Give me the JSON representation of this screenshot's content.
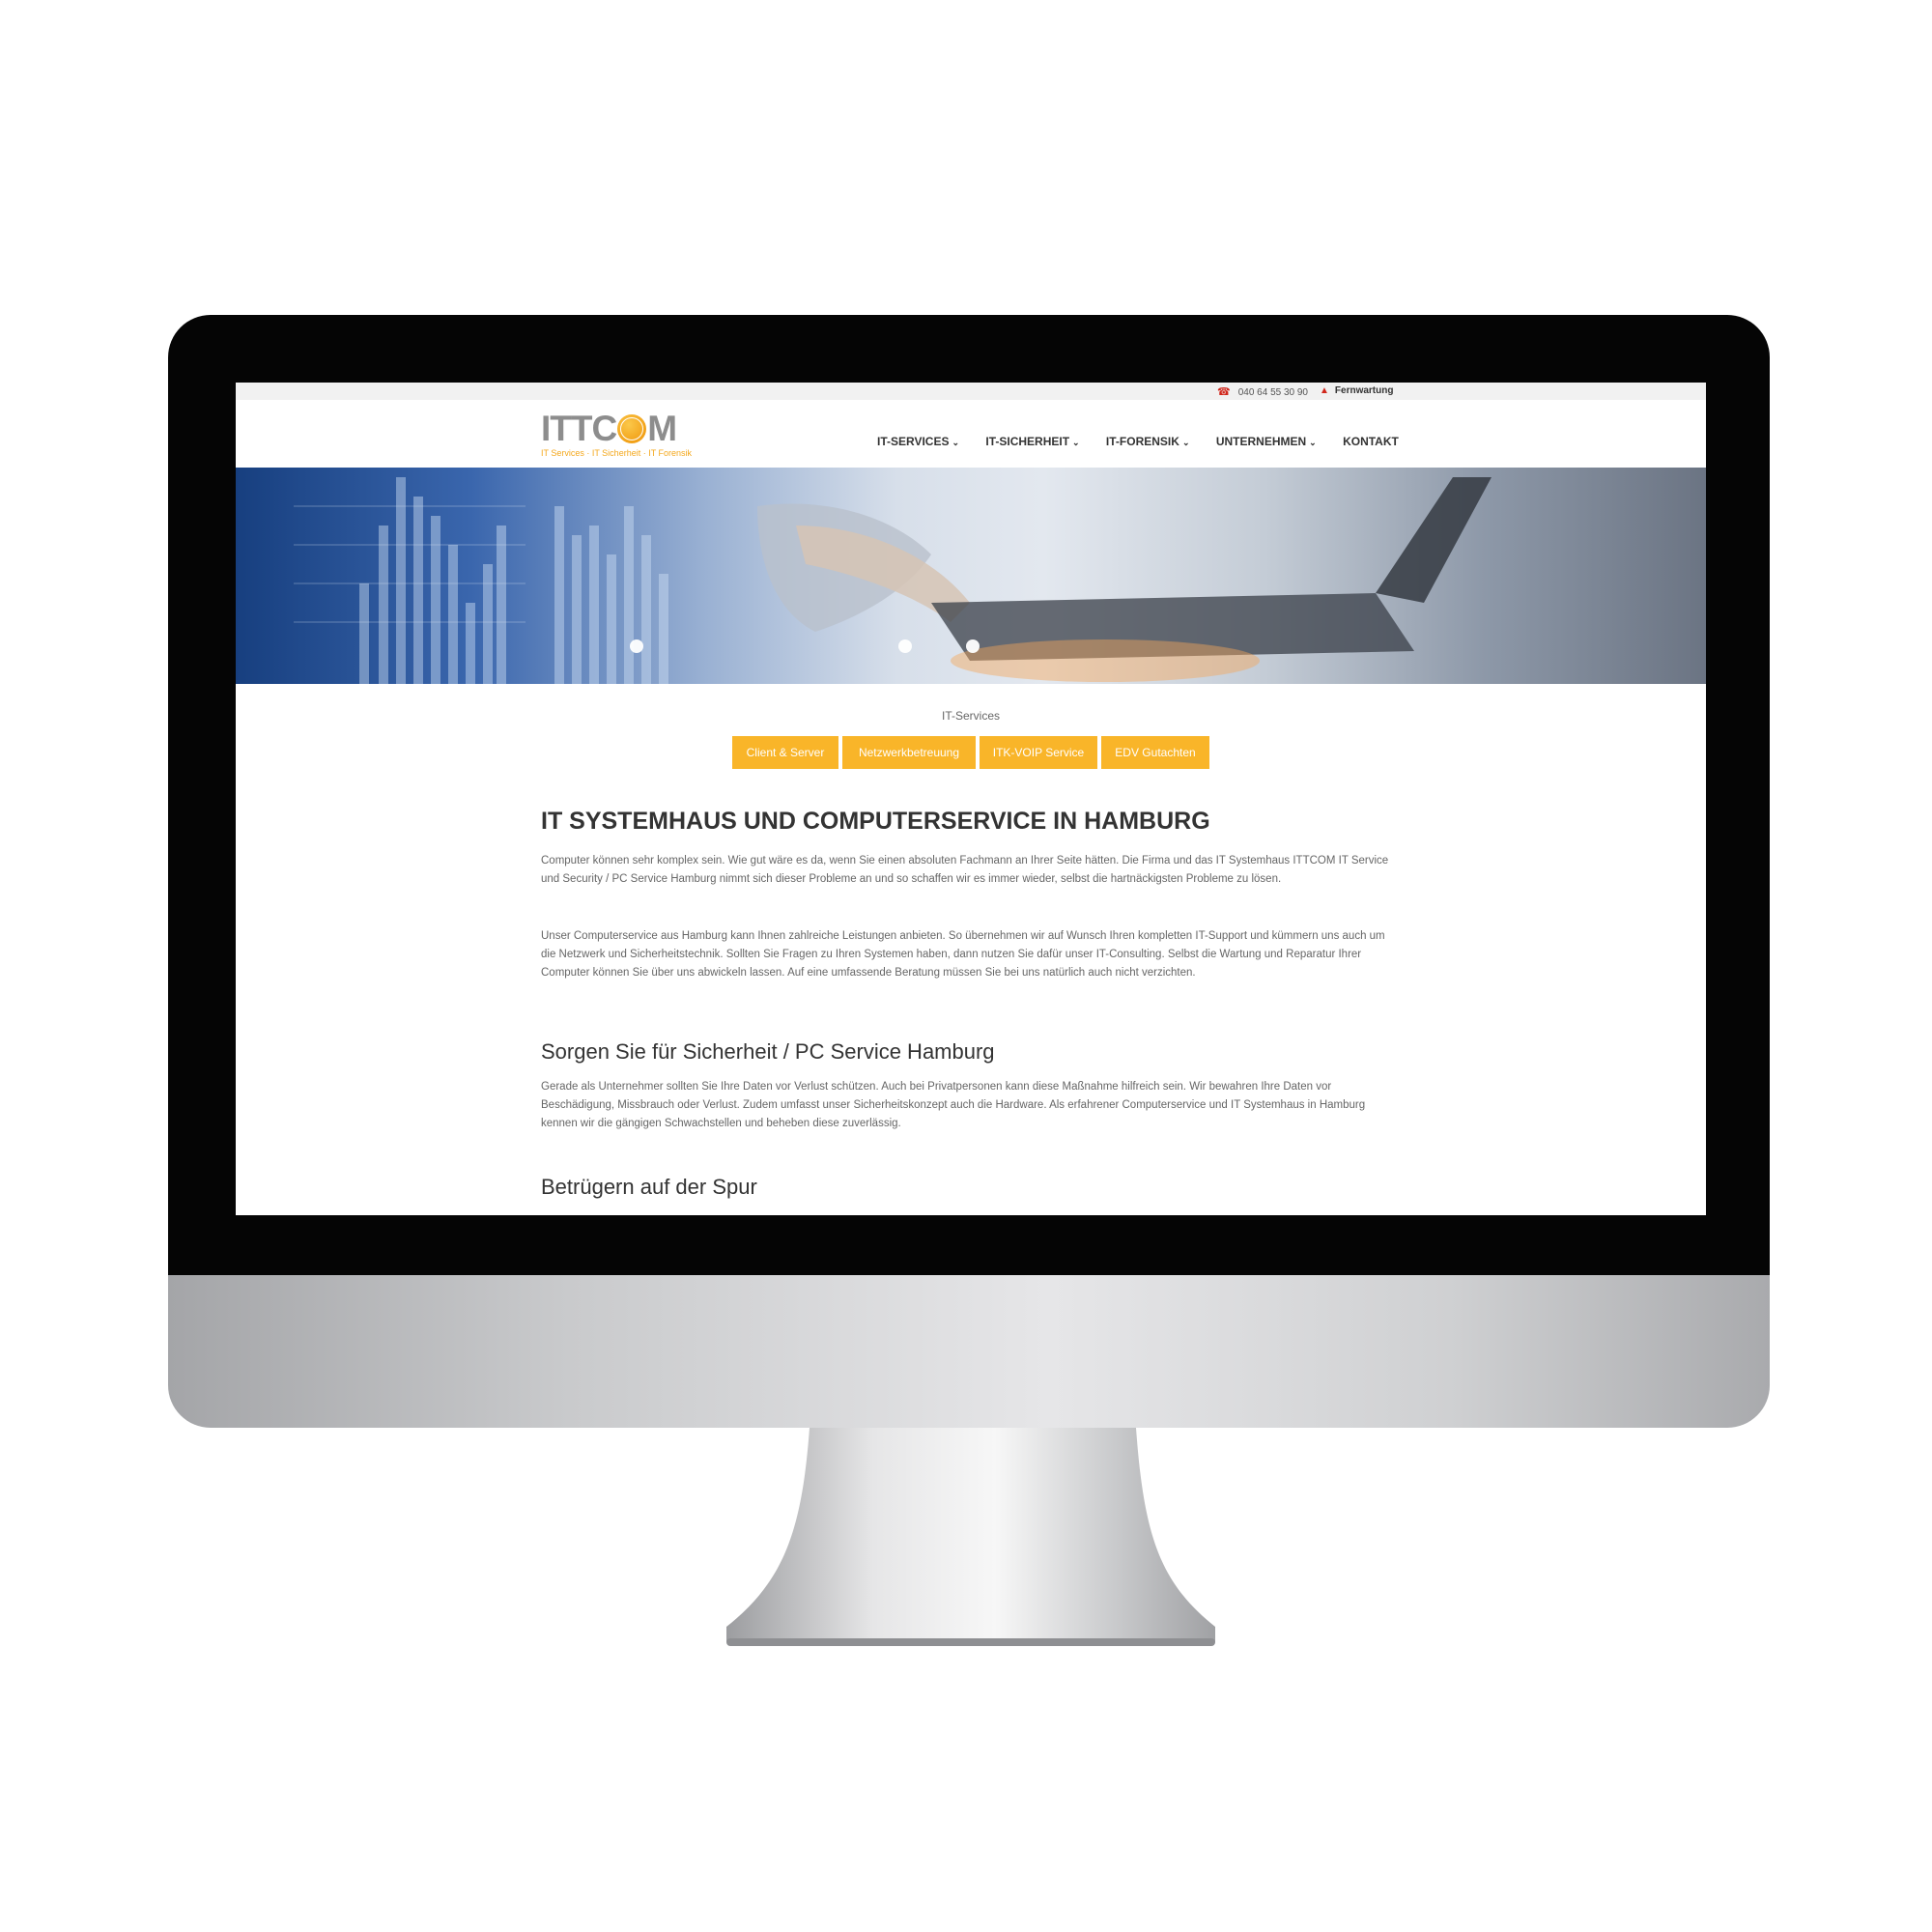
{
  "topbar": {
    "phone": "040 64 55 30 90",
    "remote": "Fernwartung",
    "phone_icon": "☎",
    "remote_icon": "▲"
  },
  "logo": {
    "prefix": "ITTC",
    "suffix": "M",
    "tagline": "IT Services · IT Sicherheit · IT Forensik"
  },
  "nav": [
    {
      "label": "IT-SERVICES",
      "dropdown": true
    },
    {
      "label": "IT-SICHERHEIT",
      "dropdown": true
    },
    {
      "label": "IT-FORENSIK",
      "dropdown": true
    },
    {
      "label": "UNTERNEHMEN",
      "dropdown": true
    },
    {
      "label": "KONTAKT",
      "dropdown": false
    }
  ],
  "chevron": "⌄",
  "breadcrumb": "IT-Services",
  "tabs": [
    "Client & Server",
    "Netzwerkbetreuung",
    "ITK-VOIP Service",
    "EDV Gutachten"
  ],
  "content": {
    "title": "IT SYSTEMHAUS UND COMPUTERSERVICE IN HAMBURG",
    "p1": "Computer können sehr komplex sein. Wie gut wäre es da, wenn Sie einen absoluten Fachmann an Ihrer Seite hätten. Die Firma und das IT Systemhaus ITTCOM IT Service und Security / PC Service Hamburg nimmt sich dieser Probleme an und so schaffen wir es immer wieder, selbst die hartnäckigsten Probleme zu lösen.",
    "p2": "Unser Computerservice aus Hamburg kann Ihnen zahlreiche Leistungen anbieten. So übernehmen wir auf Wunsch Ihren kompletten IT-Support und kümmern uns auch um die Netzwerk und Sicherheitstechnik. Sollten Sie Fragen zu Ihren Systemen haben, dann nutzen Sie dafür unser IT-Consulting. Selbst die Wartung und Reparatur Ihrer Computer können Sie über uns abwickeln lassen. Auf eine umfassende Beratung müssen Sie bei uns natürlich auch nicht verzichten.",
    "h2a": "Sorgen Sie für Sicherheit / PC Service Hamburg",
    "p3": "Gerade als Unternehmer sollten Sie Ihre Daten vor  Verlust schützen. Auch bei Privatpersonen kann diese Maßnahme hilfreich sein. Wir bewahren Ihre Daten vor Beschädigung, Missbrauch oder Verlust. Zudem umfasst unser Sicherheitskonzept auch die Hardware. Als erfahrener Computerservice und IT Systemhaus in Hamburg kennen wir die gängigen Schwachstellen und beheben diese zuverlässig.",
    "h2b": "Betrügern auf der Spur"
  },
  "colors": {
    "accent": "#f9b529",
    "phone_icon": "#d1281d"
  }
}
